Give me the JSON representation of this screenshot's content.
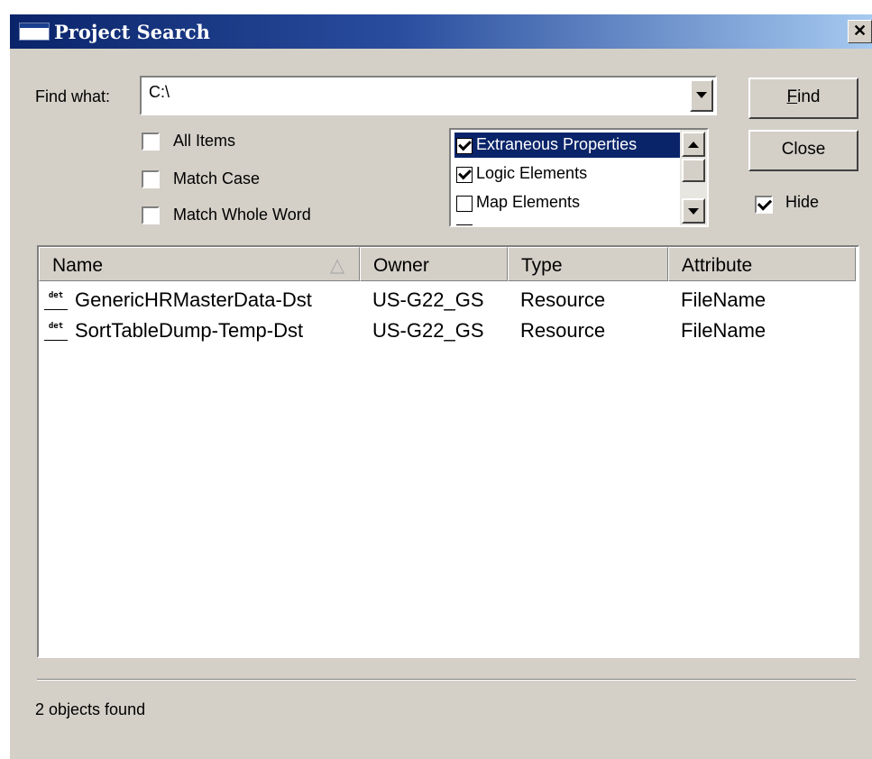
{
  "window": {
    "title": "Project Search",
    "close_glyph": "✕"
  },
  "find": {
    "label": "Find what:",
    "value": "C:\\"
  },
  "options": [
    {
      "label": "All Items",
      "checked": false
    },
    {
      "label": "Match Case",
      "checked": false
    },
    {
      "label": "Match Whole Word",
      "checked": false
    }
  ],
  "categories": [
    {
      "label": "Extraneous Properties",
      "checked": true,
      "selected": true
    },
    {
      "label": "Logic Elements",
      "checked": true,
      "selected": false
    },
    {
      "label": "Map Elements",
      "checked": false,
      "selected": false
    }
  ],
  "buttons": {
    "find": "Find",
    "find_mnemonic": "F",
    "find_rest": "ind",
    "close": "Close"
  },
  "hide": {
    "label": "Hide",
    "checked": true
  },
  "results": {
    "columns": [
      "Name",
      "Owner",
      "Type",
      "Attribute"
    ],
    "sort_glyph": "△",
    "icon_text": "det",
    "rows": [
      {
        "name": "GenericHRMasterData-Dst",
        "owner": "US-G22_GS",
        "type": "Resource",
        "attribute": "FileName"
      },
      {
        "name": "SortTableDump-Temp-Dst",
        "owner": "US-G22_GS",
        "type": "Resource",
        "attribute": "FileName"
      }
    ]
  },
  "status": "2 objects found",
  "colors": {
    "title_bar_start": "#0a246a",
    "title_bar_end": "#a6caf0",
    "dialog_bg": "#d4d0c8",
    "selection": "#0a246a"
  }
}
